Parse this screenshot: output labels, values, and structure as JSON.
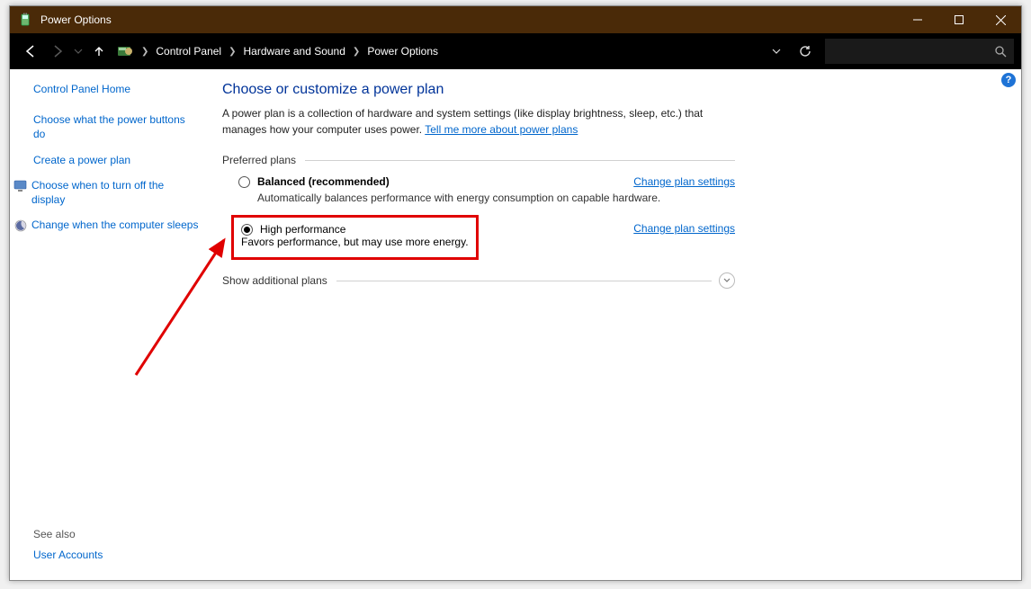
{
  "window": {
    "title": "Power Options"
  },
  "breadcrumbs": {
    "a": "Control Panel",
    "b": "Hardware and Sound",
    "c": "Power Options"
  },
  "sidebar": {
    "home": "Control Panel Home",
    "link1": "Choose what the power buttons do",
    "link2": "Create a power plan",
    "link3": "Choose when to turn off the display",
    "link4": "Change when the computer sleeps",
    "seealso": "See also",
    "useraccounts": "User Accounts"
  },
  "main": {
    "heading": "Choose or customize a power plan",
    "desc_before": "A power plan is a collection of hardware and system settings (like display brightness, sleep, etc.) that manages how your computer uses power. ",
    "desc_link": "Tell me more about power plans",
    "preferred": "Preferred plans",
    "plan1_name": "Balanced (recommended)",
    "plan1_sub": "Automatically balances performance with energy consumption on capable hardware.",
    "plan2_name": "High performance",
    "plan2_sub": "Favors performance, but may use more energy.",
    "change_link": "Change plan settings",
    "show_additional": "Show additional plans"
  },
  "help_q": "?"
}
